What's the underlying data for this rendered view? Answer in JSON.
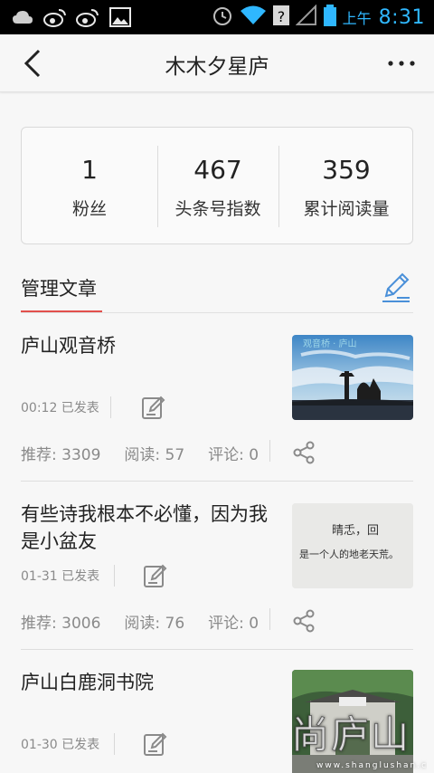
{
  "statusbar": {
    "ampm": "上午",
    "time": "8:31"
  },
  "header": {
    "title": "木木夕星庐"
  },
  "stats": [
    {
      "value": "1",
      "label": "粉丝"
    },
    {
      "value": "467",
      "label": "头条号指数"
    },
    {
      "value": "359",
      "label": "累计阅读量"
    }
  ],
  "section": {
    "title": "管理文章"
  },
  "articles": [
    {
      "title": "庐山观音桥",
      "meta": "00:12 已发表",
      "recommend": "推荐: 3309",
      "reads": "阅读: 57",
      "comments": "评论: 0",
      "thumb_caption": "观音桥  ·  庐山"
    },
    {
      "title": "有些诗我根本不必懂，因为我是小盆友",
      "meta": "01-31 已发表",
      "recommend": "推荐: 3006",
      "reads": "阅读: 76",
      "comments": "评论: 0",
      "thumb_text_line1": "晴忎，回",
      "thumb_text_line2": "是一个人的地老天荒。"
    },
    {
      "title": "庐山白鹿洞书院",
      "meta": "01-30 已发表"
    }
  ],
  "watermark": {
    "text": "尚庐山",
    "url": "www.shanglushan.com"
  },
  "colors": {
    "accent_red": "#e2504c",
    "status_blue": "#2fb7ff",
    "edit_blue": "#4a90d9"
  }
}
